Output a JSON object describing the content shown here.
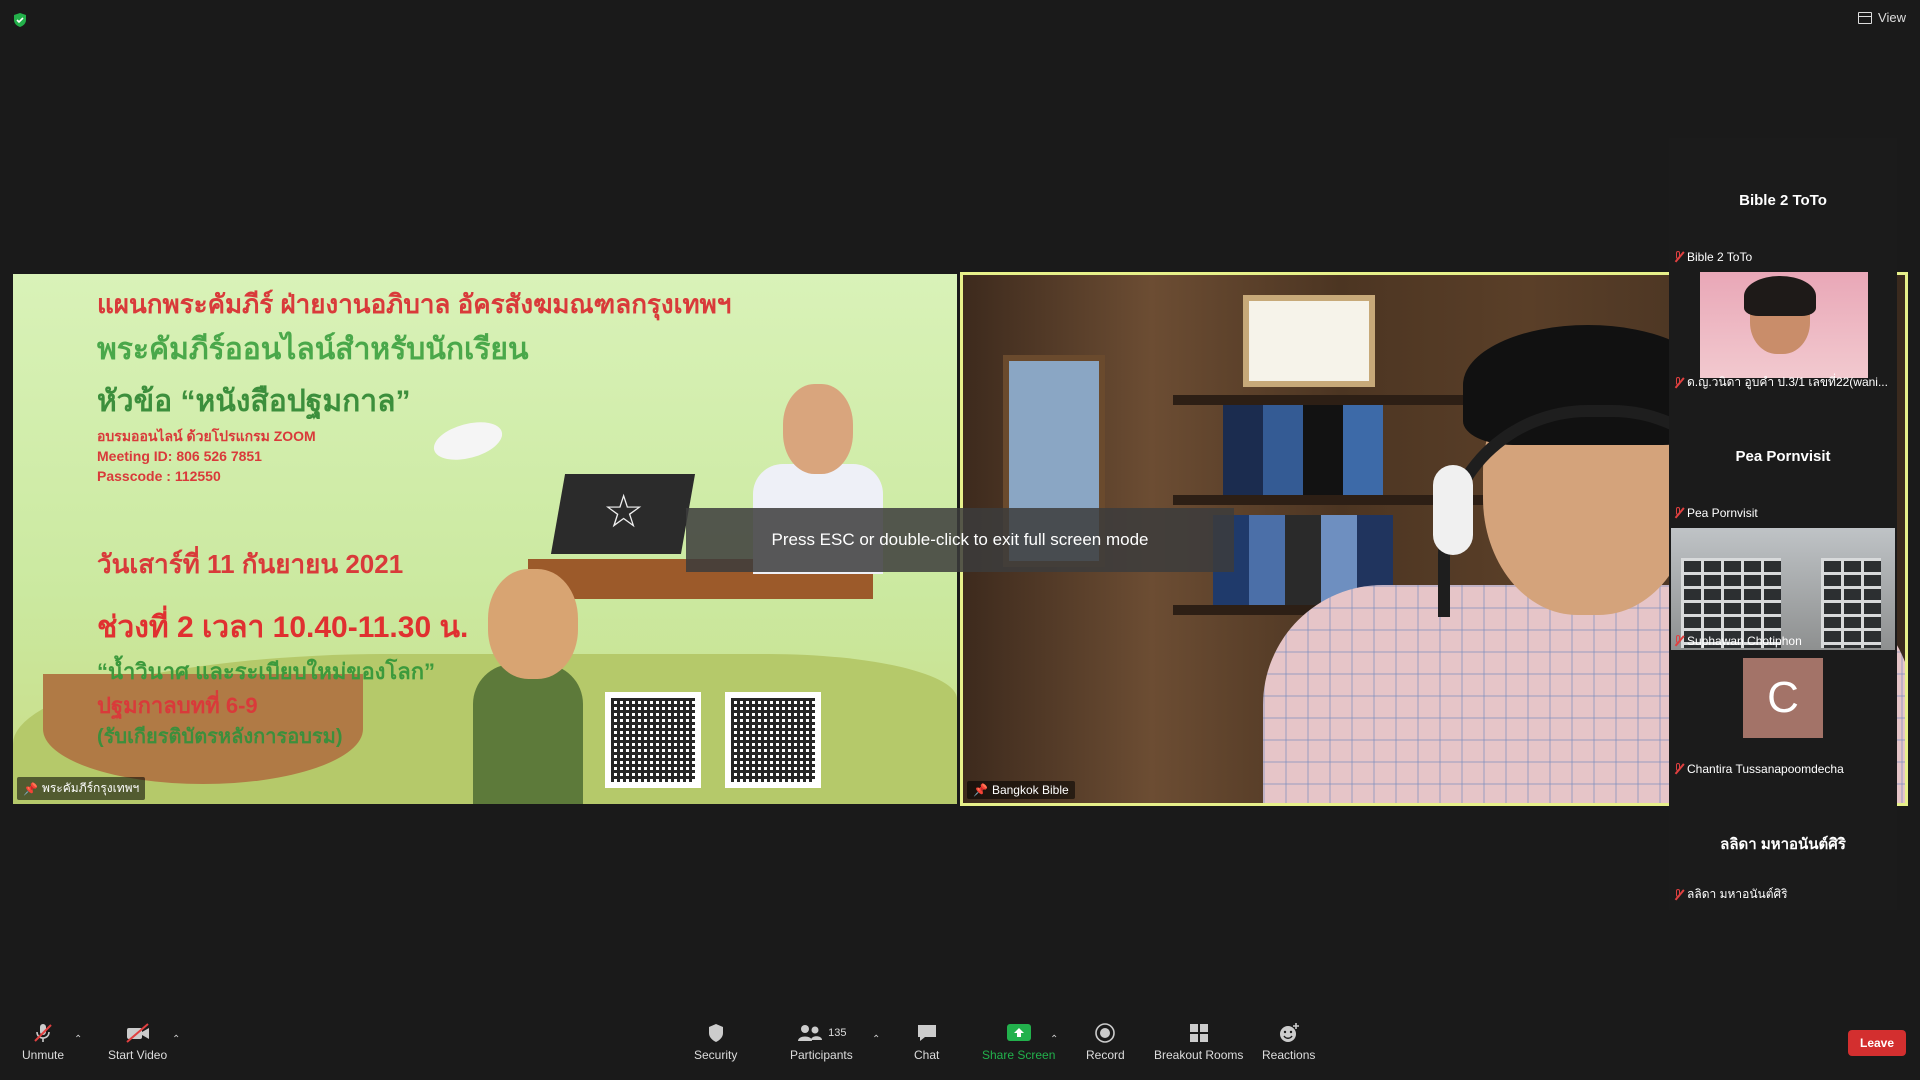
{
  "top": {
    "view_label": "View"
  },
  "share_tile": {
    "name": "พระคัมภีร์กรุงเทพฯ",
    "poster": {
      "line1": "แผนกพระคัมภีร์ ฝ่ายงานอภิบาล อัครสังฆมณฑลกรุงเทพฯ",
      "line2": "พระคัมภีร์ออนไลน์สำหรับนักเรียน",
      "line3": "หัวข้อ “หนังสือปฐมกาล”",
      "info1": "อบรมออนไลน์ ด้วยโปรแกรม ZOOM",
      "info2": "Meeting ID: 806 526 7851",
      "info3": "Passcode : 112550",
      "date": "วันเสาร์ที่ 11 กันยายน 2021",
      "slot": "ช่วงที่ 2 เวลา 10.40-11.30 น.",
      "topic": "“น้ำวินาศ และระเบียบใหม่ของโลก”",
      "chapter": "ปฐมกาลบทที่ 6-9",
      "cert": "(รับเกียรติบัตรหลังการอบรม)"
    }
  },
  "speaker_tile": {
    "name": "Bangkok Bible"
  },
  "toast": "Press ESC or double-click to exit full screen mode",
  "panel": {
    "p1": {
      "big": "Bible 2 ToTo",
      "tag": "Bible 2 ToTo"
    },
    "p2": {
      "tag": "ด.ญ.วนิดา อูบคำ ป.3/1 เลขที่22(wani..."
    },
    "p3": {
      "big": "Pea Pornvisit",
      "tag": "Pea Pornvisit"
    },
    "p4": {
      "tag": "Suphawan Chotiphon"
    },
    "p5": {
      "avatar": "C",
      "tag": "Chantira Tussanapoomdecha"
    },
    "p6": {
      "big": "ลลิดา มหาอนันต์ศิริ",
      "tag": "ลลิดา มหาอนันต์ศิริ"
    }
  },
  "toolbar": {
    "unmute": "Unmute",
    "start_video": "Start Video",
    "security": "Security",
    "participants": "Participants",
    "participants_count": "135",
    "chat": "Chat",
    "share_screen": "Share Screen",
    "record": "Record",
    "breakout": "Breakout Rooms",
    "reactions": "Reactions",
    "leave": "Leave"
  },
  "colors": {
    "active_speaker_border": "#e7f08a",
    "share_green": "#22b14c",
    "leave_red": "#d32f2f",
    "muted_red": "#e04040"
  }
}
